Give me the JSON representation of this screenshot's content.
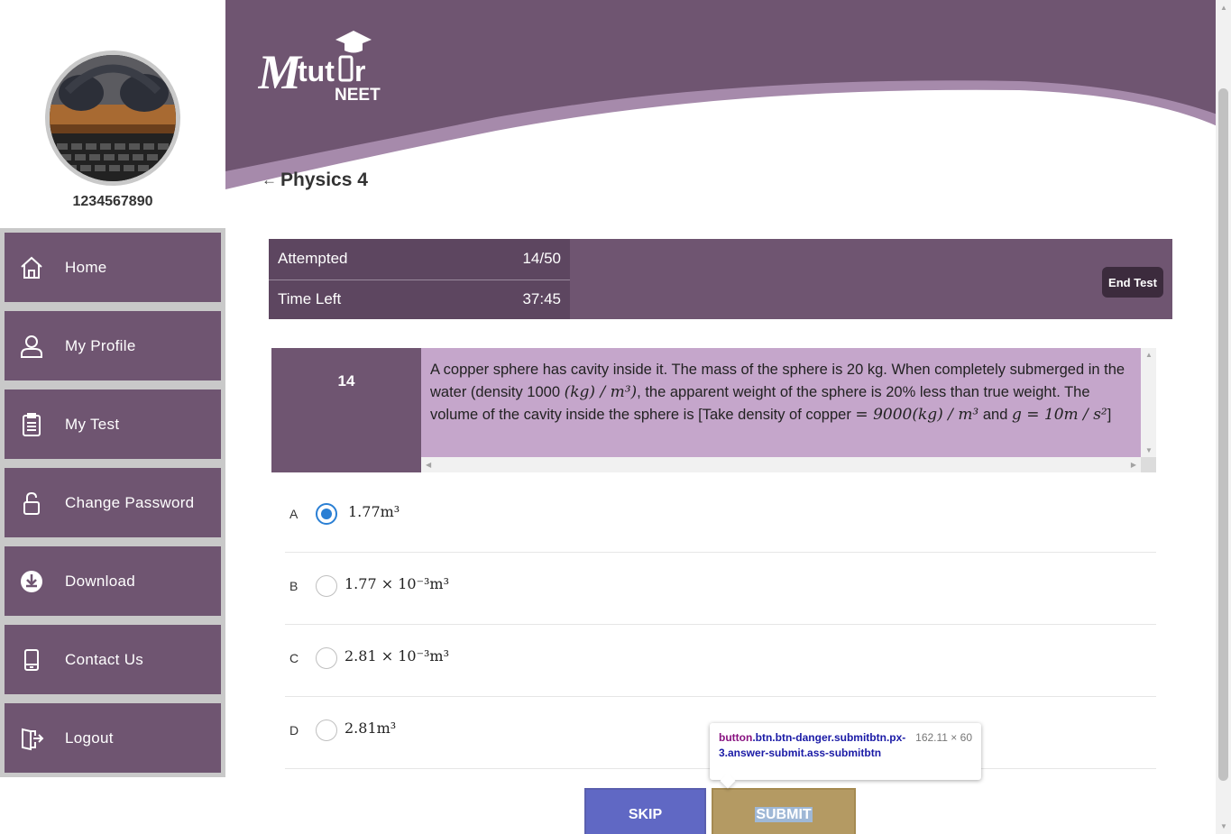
{
  "user": {
    "id": "1234567890"
  },
  "menu": [
    {
      "label": "Home",
      "icon": "home-icon"
    },
    {
      "label": "My Profile",
      "icon": "user-icon"
    },
    {
      "label": "My Test",
      "icon": "clipboard-icon"
    },
    {
      "label": "Change Password",
      "icon": "lock-icon"
    },
    {
      "label": "Download",
      "icon": "download-icon"
    },
    {
      "label": "Contact Us",
      "icon": "phone-icon"
    },
    {
      "label": "Logout",
      "icon": "logout-icon"
    }
  ],
  "brand": {
    "name": "Mtutor",
    "sub": "NEET"
  },
  "test": {
    "title": "Physics 4"
  },
  "stats": {
    "attempted_label": "Attempted",
    "attempted_value": "14/50",
    "time_label": "Time Left",
    "time_value": "37:45",
    "end_test_label": "End Test"
  },
  "question": {
    "number": "14",
    "text_1": "A copper sphere has cavity inside it. The mass of the sphere is 20 kg. When completely submerged in the water (density 1000 ",
    "math_1": "(kg) / m³)",
    "text_2": ", the apparent weight of the sphere is 20% less than true weight. The volume of the cavity inside the sphere is [Take density of copper ",
    "math_2": "= 9000(kg) / m³",
    "text_3": " and ",
    "math_3": "g = 10m / s²",
    "text_4": "]"
  },
  "options": [
    {
      "letter": "A",
      "text": "1.77m³",
      "selected": true
    },
    {
      "letter": "B",
      "text": "1.77 × 10⁻³m³",
      "selected": false
    },
    {
      "letter": "C",
      "text": "2.81 × 10⁻³m³",
      "selected": false
    },
    {
      "letter": "D",
      "text": "2.81m³",
      "selected": false
    }
  ],
  "buttons": {
    "skip": "SKIP",
    "submit": "SUBMIT"
  },
  "tooltip": {
    "tag": "button",
    "selector": ".btn.btn-danger.submitbtn.px-3.answer-submit.ass-submitbtn",
    "size": "162.11 × 60"
  },
  "colors": {
    "primary": "#6f5571",
    "stats_dark": "#5d4660",
    "question_bg": "#c5a6cb",
    "skip": "#6068c4",
    "submit": "#b49a63",
    "radio_selected": "#2a7fd4"
  }
}
